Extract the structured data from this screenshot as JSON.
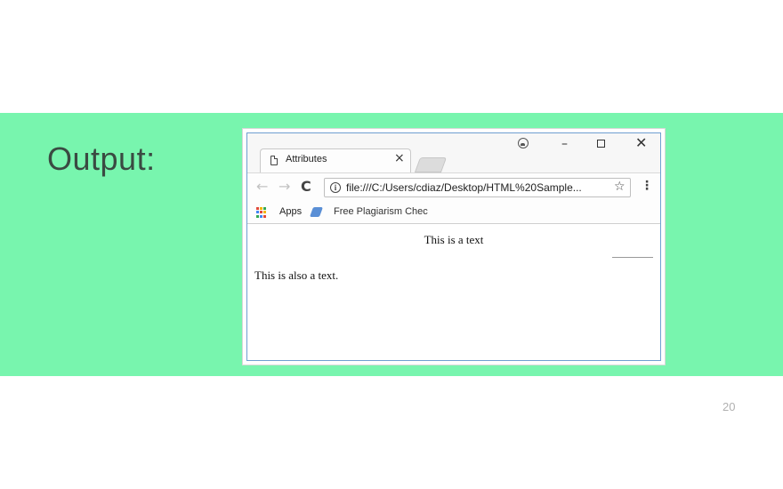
{
  "slide": {
    "label": "Output:",
    "page_number": "20",
    "band_color": "#78f5ae"
  },
  "browser": {
    "tab": {
      "title": "Attributes",
      "close_glyph": "×",
      "icon": "document-icon"
    },
    "window_controls": {
      "profile_icon": "profile-icon",
      "minimize_glyph": "–",
      "close_glyph": "✕"
    },
    "toolbar": {
      "back_glyph": "←",
      "forward_glyph": "→",
      "reload_glyph": "C",
      "info_glyph": "i",
      "url": "file:///C:/Users/cdiaz/Desktop/HTML%20Sample...",
      "star_glyph": "☆",
      "menu_glyph": "⋮"
    },
    "bookmarks": {
      "apps_label": "Apps",
      "item_label": "Free Plagiarism Chec"
    },
    "page": {
      "centered_text": "This is a text",
      "left_text": "This is also a text."
    }
  }
}
